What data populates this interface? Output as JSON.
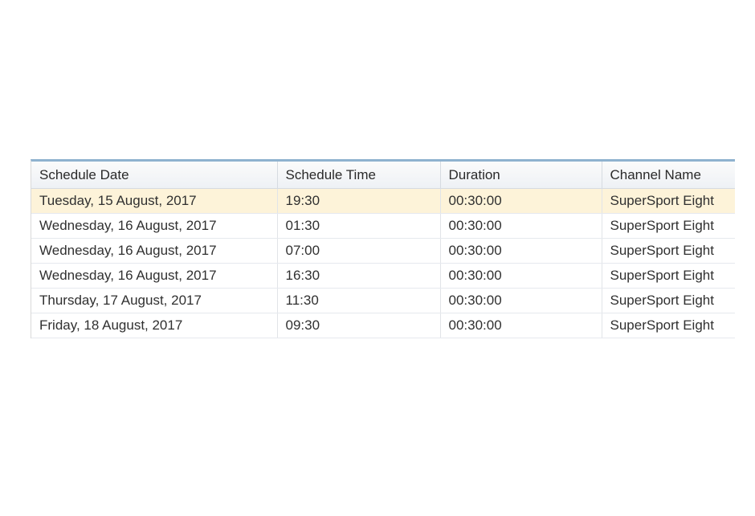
{
  "schedule_grid": {
    "columns": [
      "Schedule Date",
      "Schedule Time",
      "Duration",
      "Channel Name"
    ],
    "selected_row": 0,
    "highlight_color": "#fdf3d9",
    "header_accent_color": "#8fb2cf",
    "rows": [
      [
        "Tuesday, 15 August, 2017",
        "19:30",
        "00:30:00",
        "SuperSport Eight"
      ],
      [
        "Wednesday, 16 August, 2017",
        "01:30",
        "00:30:00",
        "SuperSport Eight"
      ],
      [
        "Wednesday, 16 August, 2017",
        "07:00",
        "00:30:00",
        "SuperSport Eight"
      ],
      [
        "Wednesday, 16 August, 2017",
        "16:30",
        "00:30:00",
        "SuperSport Eight"
      ],
      [
        "Thursday, 17 August, 2017",
        "11:30",
        "00:30:00",
        "SuperSport Eight"
      ],
      [
        "Friday, 18 August, 2017",
        "09:30",
        "00:30:00",
        "SuperSport Eight"
      ]
    ]
  }
}
